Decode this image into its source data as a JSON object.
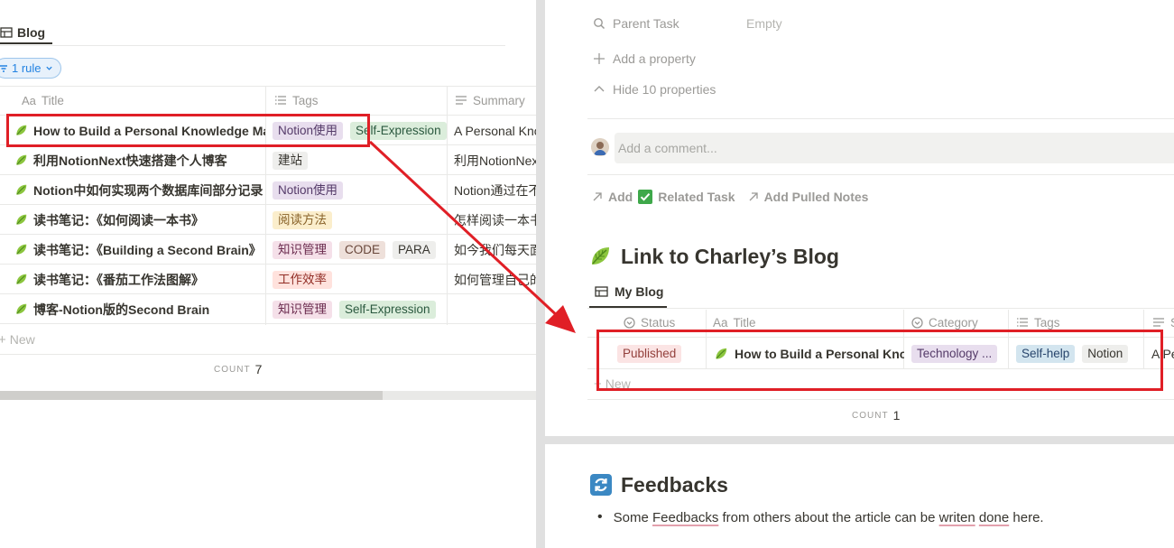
{
  "colors": {
    "accent_red": "#e01f26",
    "link_blue": "#2383e2"
  },
  "left": {
    "view_tab": {
      "label": "Blog",
      "icon": "table-icon"
    },
    "filter_pill": {
      "label": "1 rule",
      "icon": "filter-icon"
    },
    "columns": [
      {
        "label": "Title",
        "icon": "text-aa-icon",
        "prefix": "Aa"
      },
      {
        "label": "Tags",
        "icon": "list-icon"
      },
      {
        "label": "Summary",
        "icon": "lines-icon"
      }
    ],
    "rows": [
      {
        "title": "How to Build a Personal Knowledge Management System with Notion",
        "tags": [
          {
            "label": "Notion使用",
            "color": "purple"
          },
          {
            "label": "Self-Expression",
            "color": "green"
          }
        ],
        "summary": "A Personal Knowledge"
      },
      {
        "title": "利用NotionNext快速搭建个人博客",
        "tags": [
          {
            "label": "建站",
            "color": "grey"
          }
        ],
        "summary": "利用NotionNext快速"
      },
      {
        "title": "Notion中如何实现两个数据库间部分记录",
        "tags": [
          {
            "label": "Notion使用",
            "color": "purple"
          }
        ],
        "summary": "Notion通过在不同"
      },
      {
        "title": "读书笔记：《如何阅读一本书》",
        "tags": [
          {
            "label": "阅读方法",
            "color": "yellow"
          }
        ],
        "summary": "怎样阅读一本书"
      },
      {
        "title": "读书笔记：《Building a Second Brain》",
        "tags": [
          {
            "label": "知识管理",
            "color": "pink"
          },
          {
            "label": "CODE",
            "color": "brown"
          },
          {
            "label": "PARA",
            "color": "grey"
          }
        ],
        "summary": "如今我们每天面对"
      },
      {
        "title": "读书笔记：《番茄工作法图解》",
        "tags": [
          {
            "label": "工作效率",
            "color": "red"
          }
        ],
        "summary": "如何管理自己的"
      },
      {
        "title": "博客-Notion版的Second Brain",
        "tags": [
          {
            "label": "知识管理",
            "color": "pink"
          },
          {
            "label": "Self-Expression",
            "color": "green"
          }
        ],
        "summary": ""
      }
    ],
    "new_label": "New",
    "count_label": "COUNT",
    "count_value": "7"
  },
  "right": {
    "parent_task": {
      "label": "Parent Task",
      "value": "Empty"
    },
    "add_property": "Add a property",
    "hide_properties": "Hide 10 properties",
    "comment_placeholder": "Add a comment...",
    "relations": {
      "add": "Add",
      "related_task": "Related Task",
      "add_pulled_notes": "Add Pulled Notes"
    },
    "blog_heading": "Link to Charley’s Blog",
    "blog_view_tab": "My Blog",
    "blog_columns": [
      {
        "label": "Status",
        "icon": "status-icon"
      },
      {
        "label": "Title",
        "prefix": "Aa"
      },
      {
        "label": "Category",
        "icon": "select-icon"
      },
      {
        "label": "Tags",
        "icon": "list-icon"
      },
      {
        "label": "S",
        "icon": "lines-icon"
      }
    ],
    "blog_row": {
      "status": "Published",
      "title": "How to Build a Personal Knowledge Management System with Notion",
      "category": "Technology ...",
      "tags": [
        "Self-help",
        "Notion"
      ],
      "summary": "A Pe"
    },
    "new_label": "New",
    "count_label": "COUNT",
    "count_value": "1",
    "feedbacks_heading": "Feedbacks",
    "feedbacks_bullet": {
      "p1": "Some ",
      "w1": "Feedbacks",
      "p2": " from others about the article can be ",
      "w2": "writen",
      "p3": " ",
      "w3": "done",
      "p4": " here."
    }
  }
}
